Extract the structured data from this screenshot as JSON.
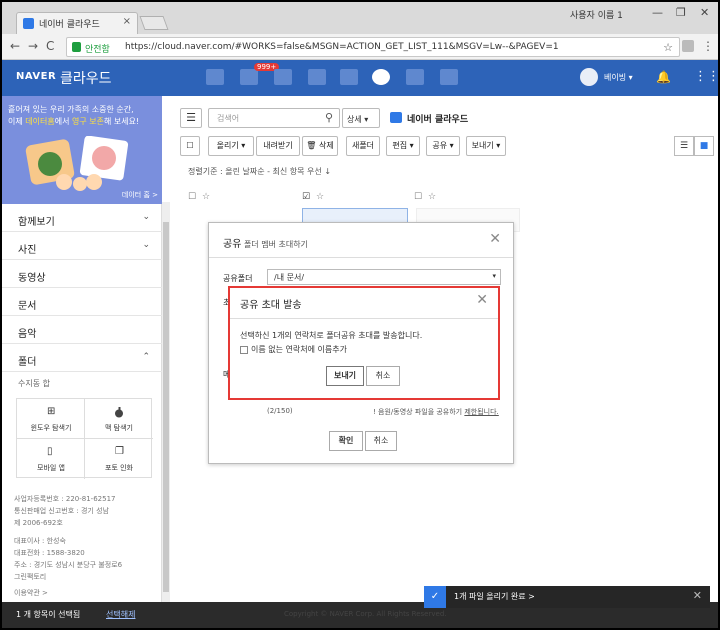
{
  "browser": {
    "tab_title": "네이버 클라우드",
    "tab_close": "×",
    "user_label": "사용자 이름 1",
    "min": "—",
    "max": "❐",
    "close": "✕",
    "back": "←",
    "forward": "→",
    "reload": "C",
    "secure": "안전함",
    "url": "https://cloud.naver.com/#WORKS=false&MSGN=ACTION_GET_LIST_111&MSGV=Lw--&PAGEV=1",
    "star": "☆",
    "menu": "⋮"
  },
  "header": {
    "logo": "NAVER",
    "service": "클라우드",
    "badge": "999+",
    "username": "베이빙 ▾",
    "bell": "🔔",
    "apps": "⋮⋮⋮"
  },
  "sidebar": {
    "banner_line1": "흩어져 있는 우리 가족의 소중한 순간,",
    "banner_line2_a": "이제 ",
    "banner_line2_hl1": "데이터홈",
    "banner_line2_b": "에서 ",
    "banner_line2_hl2": "영구 보존",
    "banner_line2_c": "해 보세요!",
    "banner_tag": "데이터 홈 >",
    "items": [
      {
        "label": "함께보기",
        "chevron": "⌄"
      },
      {
        "label": "사진",
        "chevron": "⌄"
      },
      {
        "label": "동영상",
        "chevron": ""
      },
      {
        "label": "문서",
        "chevron": ""
      },
      {
        "label": "음악",
        "chevron": ""
      },
      {
        "label": "폴더",
        "chevron": "⌃"
      }
    ],
    "subhead": "수지동 합",
    "tiles": [
      {
        "label": "윈도우 탐색기",
        "icon": "⊞"
      },
      {
        "label": "맥 탐색기",
        "icon": ""
      },
      {
        "label": "모바일 앱",
        "icon": "▯"
      },
      {
        "label": "포토 인화",
        "icon": "❐"
      }
    ],
    "footer": [
      "사업자등록번호 : 220-81-62517",
      "통신판매업 신고번호 : 경기 성남",
      "제 2006-692호",
      "대표이사 : 한성숙",
      "대표전화 : 1588-3820",
      "주소 : 경기도 성남시 분당구 불정로6",
      "그린팩토리",
      "이용약관 >"
    ]
  },
  "main": {
    "search_placeholder": "검색어",
    "search_icon": "⚲",
    "detail": "상세 ▾",
    "breadcrumb": "네이버 클라우드",
    "buttons": [
      "올리기 ▾",
      "내려받기",
      "🗑 삭제",
      "새폴더",
      "편집 ▾",
      "공유 ▾",
      "보내기 ▾"
    ],
    "sort_line": "정렬기준 : 올린 날짜순 - 최신 항목 우선 ↓",
    "checkbox_empty": "☐",
    "checkbox_checked": "☑",
    "star_empty": "☆",
    "view_list": "☰",
    "view_grid": "■"
  },
  "share_dialog": {
    "title_main": "공유",
    "title_sub": " 폴더 멤버 초대하기",
    "close": "✕",
    "folder_label": "공유폴더",
    "folder_value": "/내 문서/",
    "folder_arrow": "▾",
    "stub1": "초",
    "stub2": "메",
    "count": "(2/150)",
    "note_prefix": "! 음원/동영상 파일을 공유하기 ",
    "note_link": "제한됩니다.",
    "ok": "확인",
    "cancel": "취소"
  },
  "send_dialog": {
    "title": "공유 초대 발송",
    "close": "✕",
    "message": "선택하신 1개의 연락처로 폴더공유 초대를 발송합니다.",
    "checkbox_label": "이름 없는 연락처에 이름추가",
    "send": "보내기",
    "cancel": "취소"
  },
  "statusbar": {
    "selected": "1 개 항목이 선택됨",
    "deselect": "선택해제",
    "faint": "Copyright © NAVER Corp. All Rights Reserved."
  },
  "toast": {
    "icon": "✓",
    "text": "1개 파일 올리기 완료 >",
    "close": "✕"
  }
}
